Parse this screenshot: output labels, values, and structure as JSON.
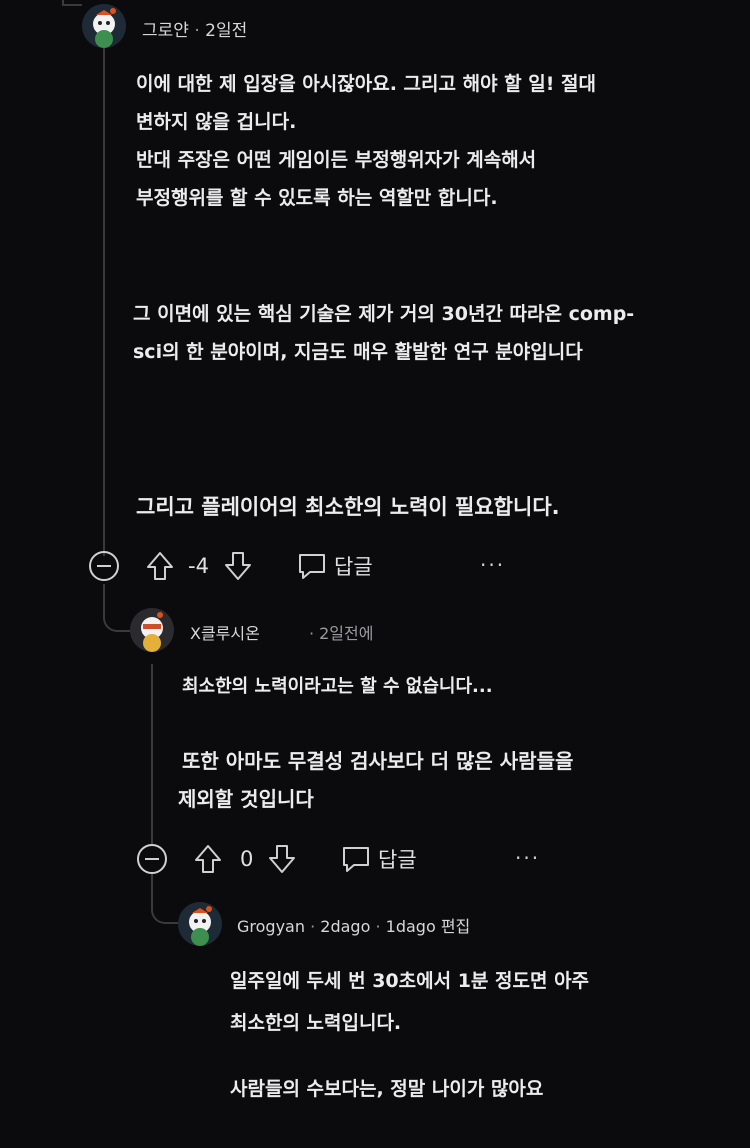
{
  "comment1": {
    "author": "그로얀",
    "time": "2일전",
    "paragraphs": [
      "이에 대한 제 입장을 아시잖아요. 그리고 해야 할 일! 절대",
      "변하지 않을 겁니다.",
      "반대 주장은 어떤 게임이든 부정행위자가 계속해서",
      "부정행위를 할 수 있도록 하는 역할만 합니다.",
      "그 이면에 있는 핵심 기술은 제가 거의 30년간 따라온 comp-",
      "sci의 한 분야이며, 지금도 매우 활발한 연구 분야입니다",
      "그리고 플레이어의 최소한의 노력이 필요합니다."
    ],
    "score": "-4",
    "reply_label": "답글",
    "more_label": "···"
  },
  "comment2": {
    "author": "X클루시온",
    "time": "2일전에",
    "paragraphs": [
      "최소한의 노력이라고는 할 수 없습니다...",
      "또한 아마도 무결성 검사보다 더 많은 사람들을",
      "제외할 것입니다"
    ],
    "score": "0",
    "reply_label": "답글",
    "more_label": "···"
  },
  "comment3": {
    "author": "Grogyan",
    "time": "2dago",
    "edited": "1dago 편집",
    "paragraphs": [
      "일주일에 두세 번 30초에서 1분 정도면 아주",
      "최소한의 노력입니다.",
      "사람들의 수보다는, 정말 나이가 많아요"
    ]
  },
  "separator": "·"
}
